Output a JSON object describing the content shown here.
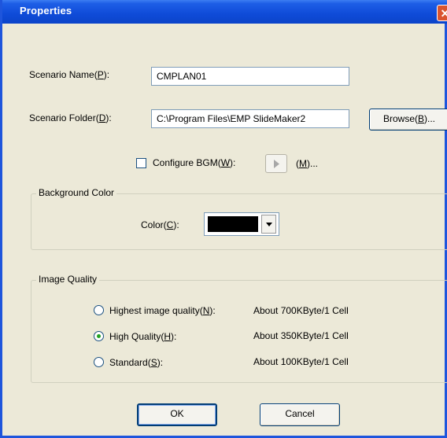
{
  "window": {
    "title": "Properties",
    "close_glyph": "✕"
  },
  "scenario_name": {
    "label_prefix": "Scenario Name(",
    "accel": "P",
    "label_suffix": "):",
    "value": "CMPLAN01"
  },
  "scenario_folder": {
    "label_prefix": "Scenario Folder(",
    "accel": "D",
    "label_suffix": "):",
    "value": "C:\\Program Files\\EMP SlideMaker2"
  },
  "browse_button": {
    "prefix": "Browse(",
    "accel": "B",
    "suffix": ")..."
  },
  "bgm": {
    "label_prefix": "Configure BGM(",
    "accel": "W",
    "label_suffix": "):",
    "checked": false,
    "play_icon": "play-icon",
    "file_prefix": "(",
    "file_accel": "M",
    "file_suffix": ")..."
  },
  "background_color": {
    "legend": "Background Color",
    "label_prefix": "Color(",
    "accel": "C",
    "label_suffix": "):",
    "value_color": "#000000"
  },
  "image_quality": {
    "legend": "Image Quality",
    "options": [
      {
        "prefix": "Highest image quality(",
        "accel": "N",
        "suffix": "):",
        "desc": "About 700KByte/1 Cell",
        "selected": false
      },
      {
        "prefix": "High Quality(",
        "accel": "H",
        "suffix": "):",
        "desc": "About 350KByte/1 Cell",
        "selected": true
      },
      {
        "prefix": "Standard(",
        "accel": "S",
        "suffix": "):",
        "desc": "About 100KByte/1 Cell",
        "selected": false
      }
    ]
  },
  "buttons": {
    "ok": "OK",
    "cancel": "Cancel"
  },
  "colors": {
    "titlebar": "#0b44c9",
    "dialog_bg": "#ece9d8",
    "close": "#d9542f"
  }
}
